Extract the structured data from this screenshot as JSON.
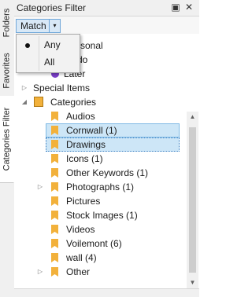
{
  "side_tabs": [
    {
      "label": "Folders"
    },
    {
      "label": "Favorites"
    },
    {
      "label": "Categories Filter"
    }
  ],
  "panel": {
    "title": "Categories Filter",
    "float_icon": "▣",
    "close_icon": "✕"
  },
  "toolbar": {
    "match_label": "Match",
    "dropdown_arrow": "▾"
  },
  "match_menu": {
    "options": [
      {
        "label": "Any",
        "selected": true
      },
      {
        "label": "All",
        "selected": false
      }
    ]
  },
  "tree": {
    "top_items": [
      {
        "label": "Personal",
        "visible_text": "rsonal"
      },
      {
        "label": "To do",
        "visible_text": "do"
      },
      {
        "label": "Later"
      }
    ],
    "special_items": "Special Items",
    "categories_root": "Categories",
    "categories": [
      {
        "label": "Audios"
      },
      {
        "label": "Cornwall (1)"
      },
      {
        "label": "Drawings"
      },
      {
        "label": "Icons (1)"
      },
      {
        "label": "Other Keywords (1)"
      },
      {
        "label": "Photographs (1)"
      },
      {
        "label": "Pictures"
      },
      {
        "label": "Stock Images (1)"
      },
      {
        "label": "Videos"
      },
      {
        "label": "Voilemont (6)"
      },
      {
        "label": "wall (4)"
      },
      {
        "label": "Other"
      }
    ],
    "expander_collapsed": "▷",
    "expander_expanded": "◢"
  },
  "scrollbar": {
    "up_arrow": "▲",
    "down_arrow": "▼"
  },
  "colors": {
    "selection": "#cde6f7",
    "tag_orange": "#f2b13b",
    "later_purple": "#7b3fc9",
    "match_button": "#d8e8f6"
  }
}
